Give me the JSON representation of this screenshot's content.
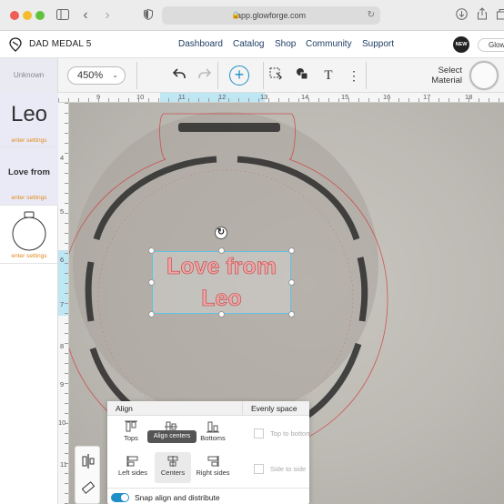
{
  "browser": {
    "url": "app.glowforge.com"
  },
  "nav": {
    "project_title": "DAD MEDAL 5",
    "links": [
      "Dashboard",
      "Catalog",
      "Shop",
      "Community",
      "Support"
    ],
    "new_badge": "NEW",
    "glow_label": "Glow"
  },
  "toolbar": {
    "unknown_label": "Unknown",
    "zoom": "450%",
    "select_material": "Select Material"
  },
  "sidebar": {
    "items": [
      {
        "label": "Leo",
        "settings": "enter settings"
      },
      {
        "label": "Love from",
        "settings": "enter settings"
      },
      {
        "label": "",
        "settings": "enter settings"
      }
    ]
  },
  "rulers": {
    "horizontal": [
      "9",
      "10",
      "11",
      "12",
      "13",
      "14",
      "15",
      "16",
      "17",
      "18"
    ],
    "vertical": [
      "4",
      "5",
      "6",
      "7",
      "8",
      "9",
      "10",
      "11"
    ]
  },
  "canvas": {
    "text_line1": "Love from",
    "text_line2": "Leo"
  },
  "align_panel": {
    "header": "Align",
    "buttons": [
      "Tops",
      "Align centers",
      "Bottoms",
      "Left sides",
      "Centers",
      "Right sides"
    ],
    "tooltip": "Align centers",
    "evenly_header": "Evenly space",
    "evenly_buttons": [
      "Top to bottom",
      "Side to side"
    ],
    "snap_label": "Snap align and distribute"
  },
  "colors": {
    "accent": "#1f8fc7",
    "settings": "#e08a1c",
    "cut_line": "#d13a3a"
  }
}
